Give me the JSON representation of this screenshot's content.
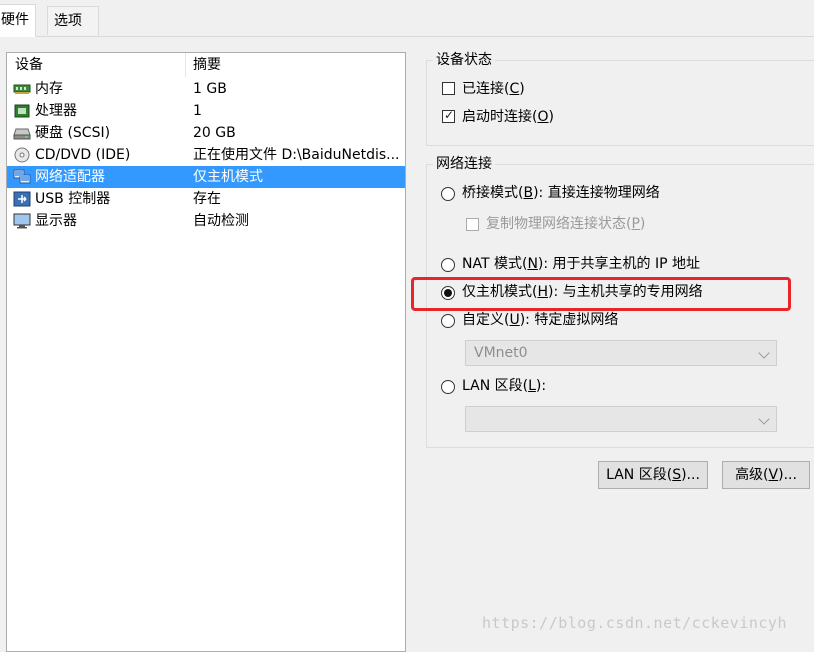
{
  "tabs": {
    "hardware": "硬件",
    "options": "选项"
  },
  "device_list": {
    "col_device": "设备",
    "col_summary": "摘要",
    "items": [
      {
        "name": "内存",
        "summary": "1 GB",
        "icon": "memory-icon"
      },
      {
        "name": "处理器",
        "summary": "1",
        "icon": "cpu-icon"
      },
      {
        "name": "硬盘 (SCSI)",
        "summary": "20 GB",
        "icon": "harddisk-icon"
      },
      {
        "name": "CD/DVD (IDE)",
        "summary": "正在使用文件 D:\\BaiduNetdis...",
        "icon": "cd-dvd-icon"
      },
      {
        "name": "网络适配器",
        "summary": "仅主机模式",
        "icon": "network-adapter-icon",
        "selected": true
      },
      {
        "name": "USB 控制器",
        "summary": "存在",
        "icon": "usb-icon"
      },
      {
        "name": "显示器",
        "summary": "自动检测",
        "icon": "monitor-icon"
      }
    ]
  },
  "device_status": {
    "title": "设备状态",
    "connected": {
      "label": "已连接(",
      "key": "C",
      "suffix": ")",
      "checked": false
    },
    "connect_at_poweron": {
      "label": "启动时连接(",
      "key": "O",
      "suffix": ")",
      "checked": true
    }
  },
  "network": {
    "title": "网络连接",
    "bridged": {
      "label": "桥接模式(",
      "key": "B",
      "suffix": "): 直接连接物理网络",
      "selected": false
    },
    "replicate": {
      "label": "复制物理网络连接状态(",
      "key": "P",
      "suffix": ")",
      "checked": false
    },
    "nat": {
      "label": "NAT 模式(",
      "key": "N",
      "suffix": "): 用于共享主机的 IP 地址",
      "selected": false
    },
    "hostonly": {
      "label": "仅主机模式(",
      "key": "H",
      "suffix": "): 与主机共享的专用网络",
      "selected": true
    },
    "custom": {
      "label": "自定义(",
      "key": "U",
      "suffix": "): 特定虚拟网络",
      "selected": false
    },
    "custom_select_value": "VMnet0",
    "lan": {
      "label": "LAN 区段(",
      "key": "L",
      "suffix": "):",
      "selected": false
    },
    "lan_select_value": ""
  },
  "buttons": {
    "lan_segments": {
      "label": "LAN 区段(",
      "key": "S",
      "suffix": ")..."
    },
    "advanced": {
      "label": "高级(",
      "key": "V",
      "suffix": ")..."
    }
  },
  "watermark": "https://blog.csdn.net/cckevincyh",
  "colors": {
    "selection": "#3399ff",
    "highlight_box": "#e8262a"
  }
}
